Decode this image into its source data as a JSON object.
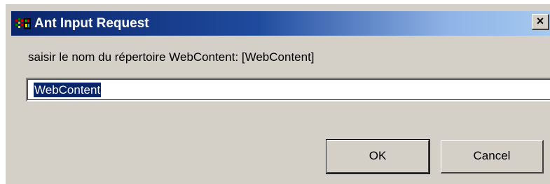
{
  "window": {
    "title": "Ant Input Request",
    "icon": "ant-app-icon",
    "close_label": "×"
  },
  "prompt": {
    "text": "saisir le nom du répertoire WebContent: [WebContent]"
  },
  "input": {
    "value": "WebContent",
    "selected": true
  },
  "buttons": {
    "ok_label": "OK",
    "cancel_label": "Cancel"
  },
  "colors": {
    "title_start": "#0a246a",
    "title_end": "#a6caf0",
    "dialog_bg": "#d4d0c8",
    "selection": "#0a246a"
  }
}
